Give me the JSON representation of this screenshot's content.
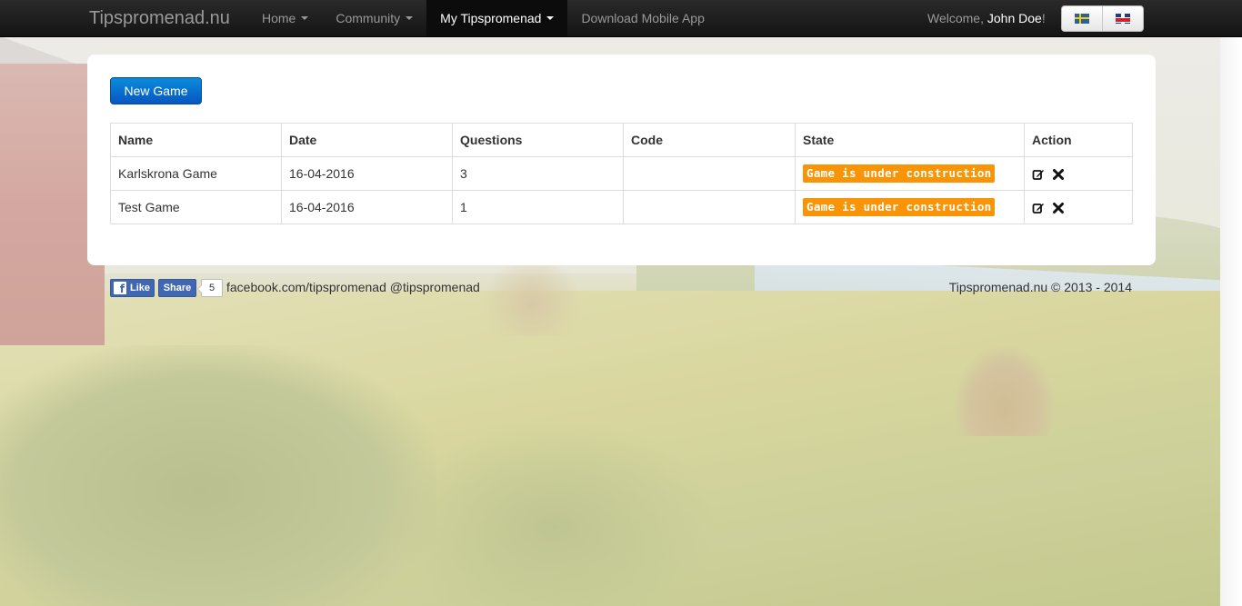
{
  "navbar": {
    "brand": "Tipspromenad.nu",
    "items": [
      {
        "label": "Home"
      },
      {
        "label": "Community"
      },
      {
        "label": "My Tipspromenad"
      },
      {
        "label": "Download Mobile App"
      }
    ],
    "welcome_prefix": "Welcome, ",
    "user_name": "John Doe",
    "welcome_suffix": "!",
    "languages": [
      {
        "icon": "sweden-flag-icon"
      },
      {
        "icon": "uk-flag-icon"
      }
    ]
  },
  "main": {
    "new_game_label": "New Game",
    "table": {
      "headers": [
        "Name",
        "Date",
        "Questions",
        "Code",
        "State",
        "Action"
      ],
      "rows": [
        {
          "name": "Karlskrona Game",
          "date": "16-04-2016",
          "questions": "3",
          "code": "",
          "state": "Game is under construction"
        },
        {
          "name": "Test Game",
          "date": "16-04-2016",
          "questions": "1",
          "code": "",
          "state": "Game is under construction"
        }
      ]
    },
    "state_color": "#f89406",
    "primary_color": "#0a6fd6"
  },
  "footer": {
    "fb_like_label": "Like",
    "fb_share_label": "Share",
    "fb_count": "5",
    "facebook_link": "facebook.com/tipspromenad",
    "twitter_link": "@tipspromenad",
    "copyright": "Tipspromenad.nu © 2013 - 2014"
  }
}
